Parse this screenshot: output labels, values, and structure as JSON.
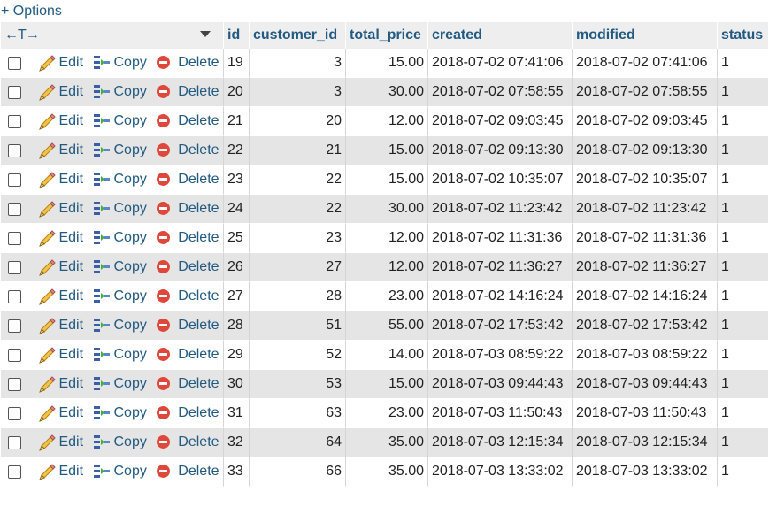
{
  "options_label": "+ Options",
  "header": {
    "arrows": "←T→",
    "columns": [
      "id",
      "customer_id",
      "total_price",
      "created",
      "modified",
      "status"
    ]
  },
  "actions": {
    "edit": "Edit",
    "copy": "Copy",
    "delete": "Delete"
  },
  "colors": {
    "link": "#235a81",
    "row_alt": "#e5e5e5",
    "header_bg": "#eeeeee",
    "delete_icon": "#e0473b"
  },
  "rows": [
    {
      "id": "19",
      "customer_id": "3",
      "total_price": "15.00",
      "created": "2018-07-02 07:41:06",
      "modified": "2018-07-02 07:41:06",
      "status": "1"
    },
    {
      "id": "20",
      "customer_id": "3",
      "total_price": "30.00",
      "created": "2018-07-02 07:58:55",
      "modified": "2018-07-02 07:58:55",
      "status": "1"
    },
    {
      "id": "21",
      "customer_id": "20",
      "total_price": "12.00",
      "created": "2018-07-02 09:03:45",
      "modified": "2018-07-02 09:03:45",
      "status": "1"
    },
    {
      "id": "22",
      "customer_id": "21",
      "total_price": "15.00",
      "created": "2018-07-02 09:13:30",
      "modified": "2018-07-02 09:13:30",
      "status": "1"
    },
    {
      "id": "23",
      "customer_id": "22",
      "total_price": "15.00",
      "created": "2018-07-02 10:35:07",
      "modified": "2018-07-02 10:35:07",
      "status": "1"
    },
    {
      "id": "24",
      "customer_id": "22",
      "total_price": "30.00",
      "created": "2018-07-02 11:23:42",
      "modified": "2018-07-02 11:23:42",
      "status": "1"
    },
    {
      "id": "25",
      "customer_id": "23",
      "total_price": "12.00",
      "created": "2018-07-02 11:31:36",
      "modified": "2018-07-02 11:31:36",
      "status": "1"
    },
    {
      "id": "26",
      "customer_id": "27",
      "total_price": "12.00",
      "created": "2018-07-02 11:36:27",
      "modified": "2018-07-02 11:36:27",
      "status": "1"
    },
    {
      "id": "27",
      "customer_id": "28",
      "total_price": "23.00",
      "created": "2018-07-02 14:16:24",
      "modified": "2018-07-02 14:16:24",
      "status": "1"
    },
    {
      "id": "28",
      "customer_id": "51",
      "total_price": "55.00",
      "created": "2018-07-02 17:53:42",
      "modified": "2018-07-02 17:53:42",
      "status": "1"
    },
    {
      "id": "29",
      "customer_id": "52",
      "total_price": "14.00",
      "created": "2018-07-03 08:59:22",
      "modified": "2018-07-03 08:59:22",
      "status": "1"
    },
    {
      "id": "30",
      "customer_id": "53",
      "total_price": "15.00",
      "created": "2018-07-03 09:44:43",
      "modified": "2018-07-03 09:44:43",
      "status": "1"
    },
    {
      "id": "31",
      "customer_id": "63",
      "total_price": "23.00",
      "created": "2018-07-03 11:50:43",
      "modified": "2018-07-03 11:50:43",
      "status": "1"
    },
    {
      "id": "32",
      "customer_id": "64",
      "total_price": "35.00",
      "created": "2018-07-03 12:15:34",
      "modified": "2018-07-03 12:15:34",
      "status": "1"
    },
    {
      "id": "33",
      "customer_id": "66",
      "total_price": "35.00",
      "created": "2018-07-03 13:33:02",
      "modified": "2018-07-03 13:33:02",
      "status": "1"
    }
  ]
}
